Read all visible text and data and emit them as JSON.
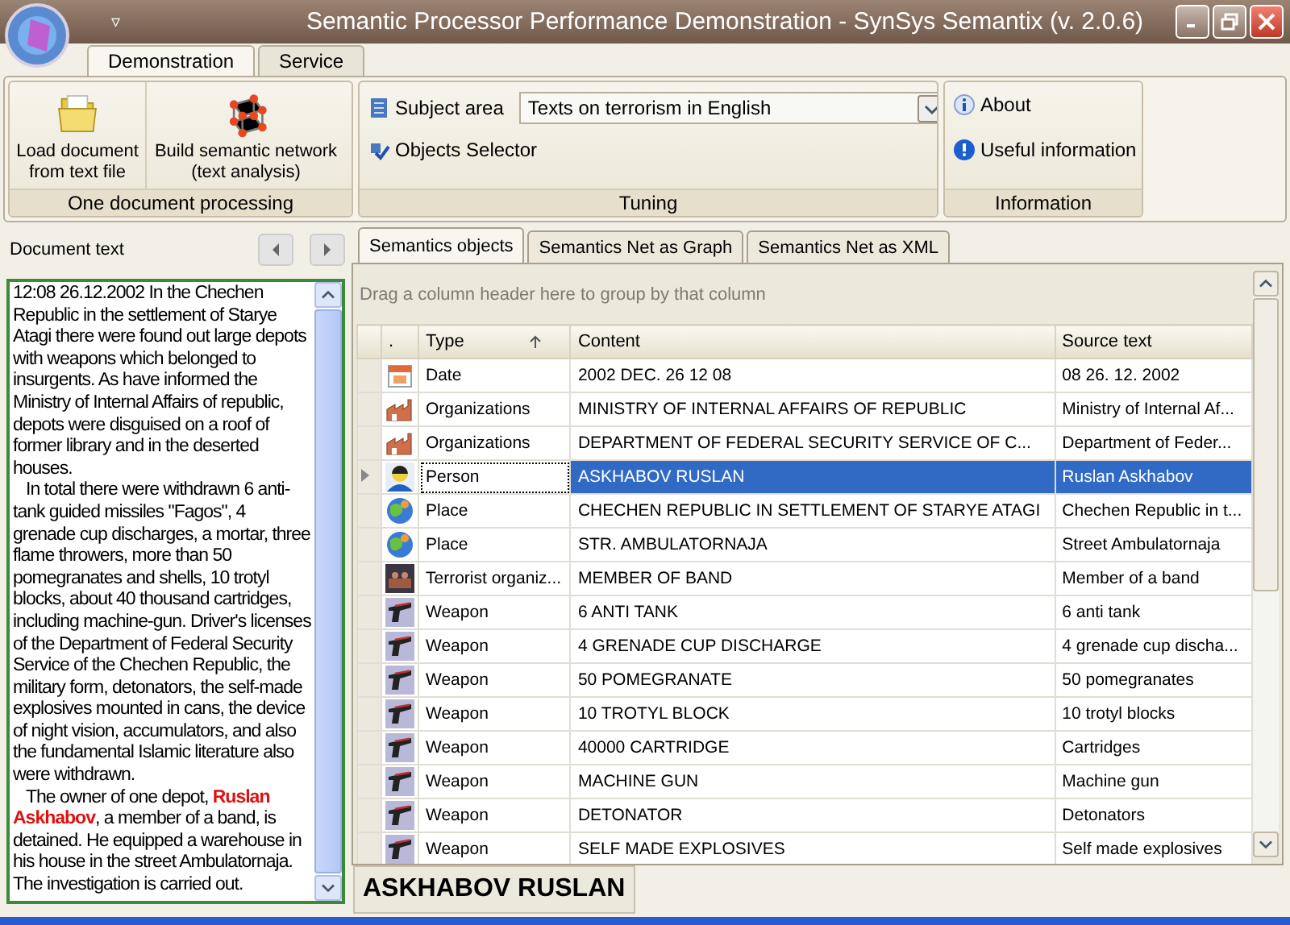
{
  "window": {
    "title": "Semantic Processor Performance Demonstration - SynSys Semantix (v. 2.0.6)",
    "quick_access": "▿"
  },
  "ribbon_tabs": [
    {
      "label": "Demonstration",
      "selected": true
    },
    {
      "label": "Service",
      "selected": false
    }
  ],
  "ribbon_groups": [
    {
      "caption": "One document processing",
      "buttons": [
        {
          "label": "Load document\nfrom text file"
        },
        {
          "label": "Build semantic network\n(text analysis)"
        }
      ]
    },
    {
      "caption": "Tuning",
      "subject_label": "Subject area",
      "subject_value": "Texts on terrorism in English",
      "selector_label": "Objects Selector"
    },
    {
      "caption": "Information",
      "links": [
        {
          "label": "About"
        },
        {
          "label": "Useful information"
        }
      ]
    }
  ],
  "document": {
    "label": "Document text",
    "paragraphs": [
      "12:08 26.12.2002   In the Chechen Republic in the settlement of Starye Atagi there were found out large depots with weapons which belonged to insurgents. As have informed the Ministry of Internal Affairs of republic, depots were disguised on a roof of former library and in the deserted houses.",
      "In total there were withdrawn 6 anti-tank guided missiles \"Fagos\", 4 grenade cup discharges, a mortar, three flame throwers, more than 50 pomegranates and shells, 10 trotyl blocks, about 40 thousand cartridges, including machine-gun. Driver's licenses of the Department of Federal Security Service of the Chechen Republic, the military form, detonators, the self-made explosives mounted in cans, the device of night vision, accumulators, and also the fundamental Islamic literature also were withdrawn.",
      "The owner of one depot, **Ruslan Askhabov**, a member of a band, is detained. He equipped a warehouse in his house in the street Ambulatornaja. The investigation is carried out."
    ]
  },
  "result_tabs": [
    {
      "label": "Semantics objects",
      "selected": true
    },
    {
      "label": "Semantics Net as Graph",
      "selected": false
    },
    {
      "label": "Semantics Net as XML",
      "selected": false
    }
  ],
  "grid": {
    "group_hint": "Drag a column header here to group by that column",
    "columns": [
      ".",
      "Type",
      "Content",
      "Source text"
    ],
    "rows": [
      {
        "kind": "date",
        "type": "Date",
        "content": "2002 DEC. 26 12 08",
        "source": "08 26. 12. 2002",
        "selected": false
      },
      {
        "kind": "organization",
        "type": "Organizations",
        "content": "MINISTRY OF INTERNAL AFFAIRS OF REPUBLIC",
        "source": "Ministry of Internal Af...",
        "selected": false
      },
      {
        "kind": "organization",
        "type": "Organizations",
        "content": "DEPARTMENT OF FEDERAL SECURITY SERVICE OF C...",
        "source": "Department of Feder...",
        "selected": false
      },
      {
        "kind": "person",
        "type": "Person",
        "content": "ASKHABOV RUSLAN",
        "source": "Ruslan Askhabov",
        "selected": true
      },
      {
        "kind": "place",
        "type": "Place",
        "content": "CHECHEN REPUBLIC IN SETTLEMENT OF STARYE ATAGI",
        "source": "Chechen Republic in t...",
        "selected": false
      },
      {
        "kind": "place",
        "type": "Place",
        "content": "STR. AMBULATORNAJA",
        "source": "Street Ambulatornaja",
        "selected": false
      },
      {
        "kind": "terrorist",
        "type": "Terrorist organiz...",
        "content": "MEMBER OF BAND",
        "source": "Member of a band",
        "selected": false
      },
      {
        "kind": "weapon",
        "type": "Weapon",
        "content": "6 ANTI TANK",
        "source": "6 anti tank",
        "selected": false
      },
      {
        "kind": "weapon",
        "type": "Weapon",
        "content": "4 GRENADE CUP DISCHARGE",
        "source": "4 grenade cup discha...",
        "selected": false
      },
      {
        "kind": "weapon",
        "type": "Weapon",
        "content": "50 POMEGRANATE",
        "source": "50 pomegranates",
        "selected": false
      },
      {
        "kind": "weapon",
        "type": "Weapon",
        "content": "10 TROTYL BLOCK",
        "source": "10 trotyl blocks",
        "selected": false
      },
      {
        "kind": "weapon",
        "type": "Weapon",
        "content": "40000 CARTRIDGE",
        "source": "Cartridges",
        "selected": false
      },
      {
        "kind": "weapon",
        "type": "Weapon",
        "content": "MACHINE GUN",
        "source": "Machine gun",
        "selected": false
      },
      {
        "kind": "weapon",
        "type": "Weapon",
        "content": "DETONATOR",
        "source": "Detonators",
        "selected": false
      },
      {
        "kind": "weapon",
        "type": "Weapon",
        "content": "SELF MADE EXPLOSIVES",
        "source": "Self made explosives",
        "selected": false
      }
    ]
  },
  "selected_object": "ASKHABOV RUSLAN"
}
